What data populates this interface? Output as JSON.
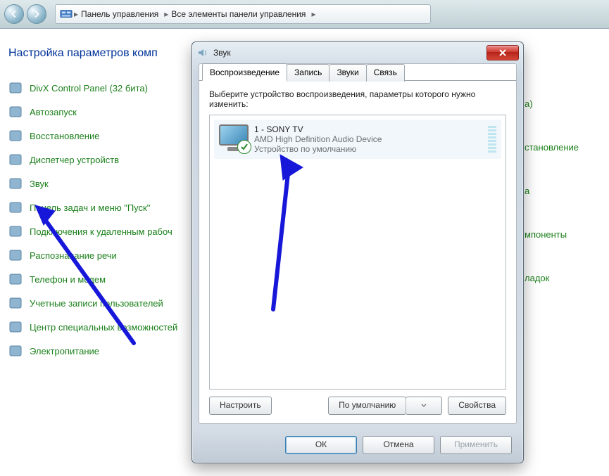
{
  "breadcrumb": {
    "level1": "Панель управления",
    "level2": "Все элементы панели управления"
  },
  "page_title": "Настройка параметров комп",
  "items": [
    "DivX Control Panel (32 бита)",
    "Автозапуск",
    "Восстановление",
    "Диспетчер устройств",
    "Звук",
    "Панель задач и меню \"Пуск\"",
    "Подключения к удаленным рабоч",
    "Распознавание речи",
    "Телефон и модем",
    "Учетные записи пользователей",
    "Центр специальных возможностей",
    "Электропитание"
  ],
  "right_peek": [
    "а)",
    "становление",
    "а",
    "мпоненты",
    "ладок"
  ],
  "dialog": {
    "title": "Звук",
    "tabs": [
      "Воспроизведение",
      "Запись",
      "Звуки",
      "Связь"
    ],
    "active_tab": 0,
    "instructions": "Выберите устройство воспроизведения, параметры которого нужно изменить:",
    "devices": [
      {
        "name": "1 - SONY TV",
        "driver": "AMD High Definition Audio Device",
        "status": "Устройство по умолчанию",
        "default": true
      }
    ],
    "buttons": {
      "configure": "Настроить",
      "set_default": "По умолчанию",
      "properties": "Свойства",
      "ok": "ОК",
      "cancel": "Отмена",
      "apply": "Применить"
    }
  }
}
